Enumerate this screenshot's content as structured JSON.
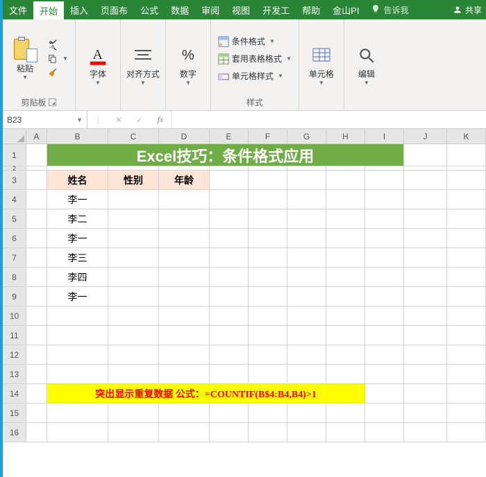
{
  "menu": {
    "tabs": [
      "文件",
      "开始",
      "插入",
      "页面布",
      "公式",
      "数据",
      "审阅",
      "视图",
      "开发工",
      "帮助",
      "金山PI"
    ],
    "tell_me": "告诉我",
    "share": "共享"
  },
  "ribbon": {
    "clipboard": {
      "paste": "粘贴",
      "label": "剪贴板"
    },
    "font": {
      "title": "字体"
    },
    "align": {
      "title": "对齐方式"
    },
    "number": {
      "title": "数字"
    },
    "styles": {
      "cond_fmt": "条件格式",
      "table_fmt": "套用表格格式",
      "cell_style": "单元格样式",
      "label": "样式"
    },
    "cells": {
      "title": "单元格"
    },
    "editing": {
      "title": "编辑"
    }
  },
  "namebox": "B23",
  "cols": [
    "A",
    "B",
    "C",
    "D",
    "E",
    "F",
    "G",
    "H",
    "I",
    "J",
    "K"
  ],
  "rows": [
    "1",
    "2",
    "3",
    "4",
    "5",
    "6",
    "7",
    "8",
    "9",
    "10",
    "11",
    "12",
    "13",
    "14",
    "15",
    "16"
  ],
  "title": "Excel技巧：条件格式应用",
  "tbl_headers": {
    "name": "姓名",
    "sex": "性别",
    "age": "年龄"
  },
  "names": [
    "李一",
    "李二",
    "李一",
    "李三",
    "李四",
    "李一"
  ],
  "formula_note": "突出显示重复数据   公式：=COUNTIF(B$4:B4,B4)>1",
  "chart_data": {
    "type": "table",
    "title": "Excel技巧：条件格式应用",
    "columns": [
      "姓名",
      "性别",
      "年龄"
    ],
    "rows": [
      [
        "李一",
        "",
        ""
      ],
      [
        "李二",
        "",
        ""
      ],
      [
        "李一",
        "",
        ""
      ],
      [
        "李三",
        "",
        ""
      ],
      [
        "李四",
        "",
        ""
      ],
      [
        "李一",
        "",
        ""
      ]
    ],
    "annotation": "突出显示重复数据   公式：=COUNTIF(B$4:B4,B4)>1"
  }
}
